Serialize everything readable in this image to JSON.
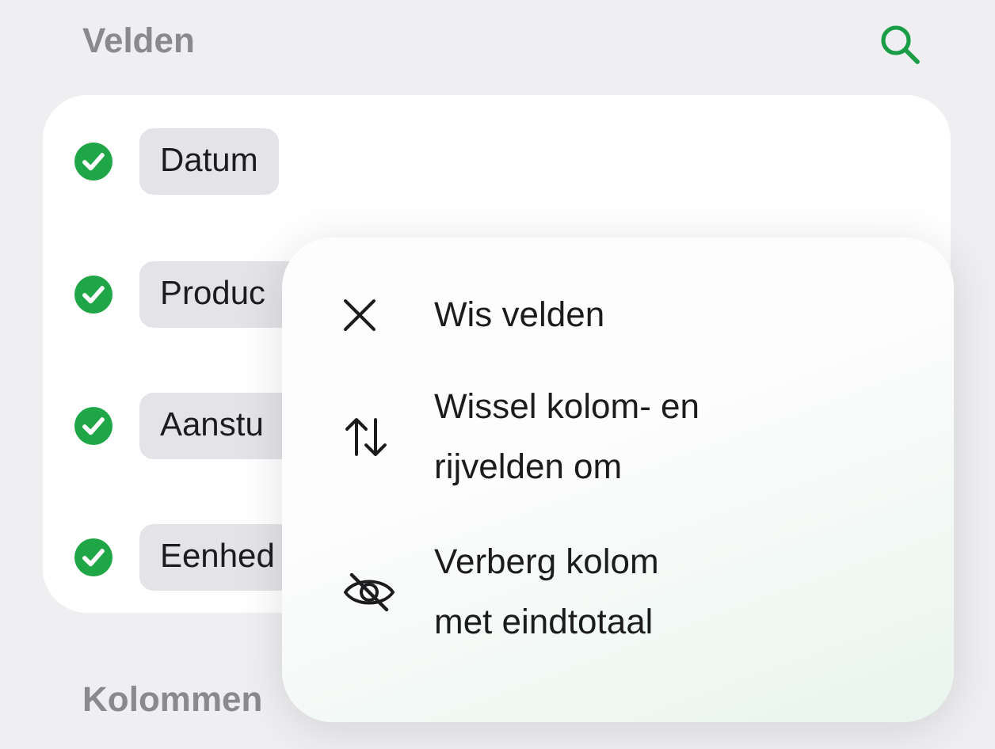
{
  "header": {
    "title": "Velden"
  },
  "fields": [
    {
      "label": "Datum",
      "checked": true
    },
    {
      "label": "Produc",
      "checked": true
    },
    {
      "label": "Aanstu",
      "checked": true
    },
    {
      "label": "Eenhed",
      "checked": true
    }
  ],
  "menu": {
    "items": [
      {
        "kind": "clear",
        "label": "Wis velden"
      },
      {
        "kind": "swap",
        "label": "Wissel kolom- en\nrijvelden om"
      },
      {
        "kind": "hide",
        "label": "Verberg kolom\nmet eindtotaal"
      }
    ]
  },
  "section": {
    "title": "Kolommen"
  }
}
